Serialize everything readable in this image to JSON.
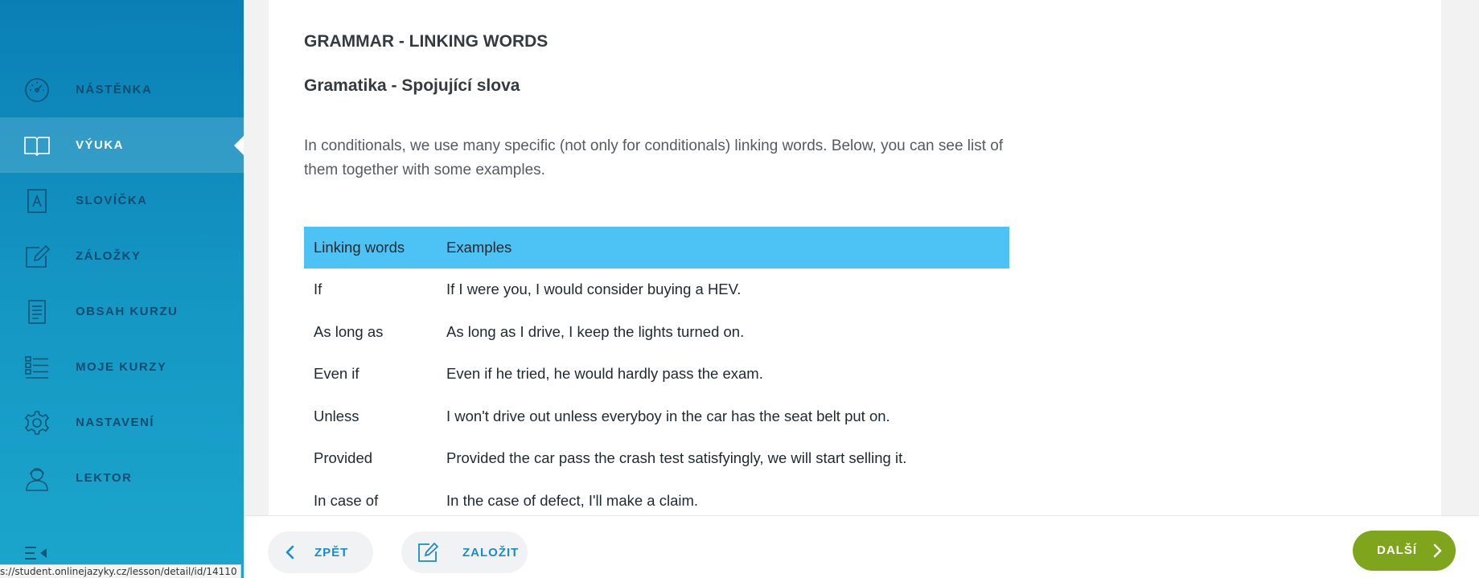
{
  "sidebar": {
    "items": [
      {
        "label": "NÁSTĚNKA",
        "icon": "dashboard-gauge-icon",
        "active": false
      },
      {
        "label": "VÝUKA",
        "icon": "open-book-icon",
        "active": true
      },
      {
        "label": "SLOVÍČKA",
        "icon": "vocabulary-card-icon",
        "active": false
      },
      {
        "label": "ZÁLOŽKY",
        "icon": "edit-note-icon",
        "active": false
      },
      {
        "label": "OBSAH KURZU",
        "icon": "document-list-icon",
        "active": false
      },
      {
        "label": "MOJE KURZY",
        "icon": "course-list-icon",
        "active": false
      },
      {
        "label": "NASTAVENÍ",
        "icon": "gear-icon",
        "active": false
      },
      {
        "label": "LEKTOR",
        "icon": "tutor-headset-icon",
        "active": false
      }
    ],
    "collapse_icon": "collapse-menu-icon"
  },
  "lesson": {
    "title": "GRAMMAR - LINKING WORDS",
    "subtitle": "Gramatika - Spojující slova",
    "intro": "In conditionals, we use many specific (not only for conditionals) linking words. Below, you can see list of them together with some examples."
  },
  "table": {
    "headers": [
      "Linking words",
      "Examples"
    ],
    "rows": [
      [
        "If",
        "If I were you, I would consider buying a HEV."
      ],
      [
        "As long as",
        "As long as I drive, I keep the lights turned on."
      ],
      [
        "Even if",
        "Even if he tried, he would hardly pass the exam."
      ],
      [
        "Unless",
        "I won't drive out unless everyboy in the car has the seat belt put on."
      ],
      [
        "Provided",
        "Provided the car pass the crash test satisfyingly, we will start selling it."
      ],
      [
        "In case of",
        "In the case of defect, I'll make a claim."
      ]
    ]
  },
  "bottom_bar": {
    "back_label": "ZPĚT",
    "bookmark_label": "ZALOŽIT",
    "next_label": "DALŠÍ"
  },
  "status_bar": {
    "url": "s://student.onlinejazyky.cz/lesson/detail/id/14110"
  },
  "colors": {
    "sidebar_top": "#0a7fb6",
    "sidebar_bottom": "#1ba6cc",
    "table_header": "#4dc3f5",
    "accent_blue": "#1a8cc8",
    "next_button": "#7fa51d"
  }
}
